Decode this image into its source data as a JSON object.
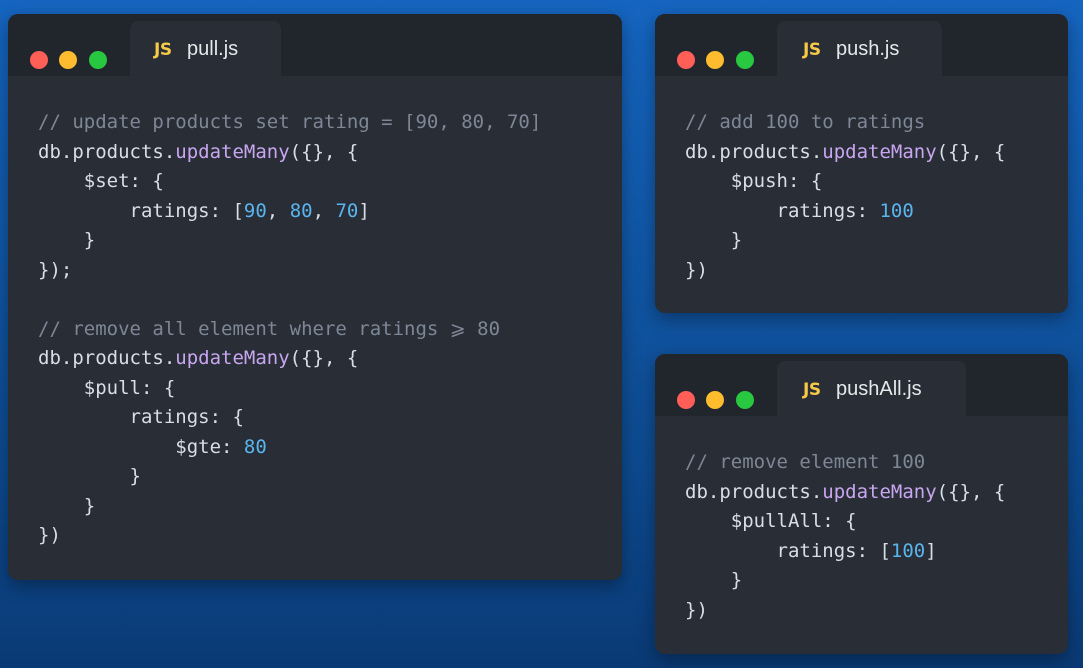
{
  "colors": {
    "red": "#ff5f57",
    "yellow": "#febc2e",
    "green": "#28c840",
    "js": "#f7c948",
    "comment": "#7e8795",
    "method": "#c8a6f0",
    "number": "#5ab5ee"
  },
  "windows": [
    {
      "id": "pull",
      "icon": "JS",
      "filename": "pull.js",
      "lines": [
        [
          {
            "t": "// update products set rating = [90, 80, 70]",
            "c": "c"
          }
        ],
        [
          {
            "t": "db.products."
          },
          {
            "t": "updateMany",
            "c": "f"
          },
          {
            "t": "({}, {"
          }
        ],
        [
          {
            "t": "    $set: {"
          }
        ],
        [
          {
            "t": "        ratings: ["
          },
          {
            "t": "90",
            "c": "n"
          },
          {
            "t": ", "
          },
          {
            "t": "80",
            "c": "n"
          },
          {
            "t": ", "
          },
          {
            "t": "70",
            "c": "n"
          },
          {
            "t": "]"
          }
        ],
        [
          {
            "t": "    }"
          }
        ],
        [
          {
            "t": "});"
          }
        ],
        [
          {
            "t": ""
          }
        ],
        [
          {
            "t": "// remove all element where ratings ⩾ 80",
            "c": "c"
          }
        ],
        [
          {
            "t": "db.products."
          },
          {
            "t": "updateMany",
            "c": "f"
          },
          {
            "t": "({}, {"
          }
        ],
        [
          {
            "t": "    $pull: {"
          }
        ],
        [
          {
            "t": "        ratings: {"
          }
        ],
        [
          {
            "t": "            $gte: "
          },
          {
            "t": "80",
            "c": "n"
          }
        ],
        [
          {
            "t": "        }"
          }
        ],
        [
          {
            "t": "    }"
          }
        ],
        [
          {
            "t": "})"
          }
        ]
      ]
    },
    {
      "id": "push",
      "icon": "JS",
      "filename": "push.js",
      "lines": [
        [
          {
            "t": "// add 100 to ratings",
            "c": "c"
          }
        ],
        [
          {
            "t": "db.products."
          },
          {
            "t": "updateMany",
            "c": "f"
          },
          {
            "t": "({}, {"
          }
        ],
        [
          {
            "t": "    $push: {"
          }
        ],
        [
          {
            "t": "        ratings: "
          },
          {
            "t": "100",
            "c": "n"
          }
        ],
        [
          {
            "t": "    }"
          }
        ],
        [
          {
            "t": "})"
          }
        ]
      ]
    },
    {
      "id": "pushAll",
      "icon": "JS",
      "filename": "pushAll.js",
      "lines": [
        [
          {
            "t": "// remove element 100",
            "c": "c"
          }
        ],
        [
          {
            "t": "db.products."
          },
          {
            "t": "updateMany",
            "c": "f"
          },
          {
            "t": "({}, {"
          }
        ],
        [
          {
            "t": "    $pullAll: {"
          }
        ],
        [
          {
            "t": "        ratings: ["
          },
          {
            "t": "100",
            "c": "n"
          },
          {
            "t": "]"
          }
        ],
        [
          {
            "t": "    }"
          }
        ],
        [
          {
            "t": "})"
          }
        ]
      ]
    }
  ]
}
